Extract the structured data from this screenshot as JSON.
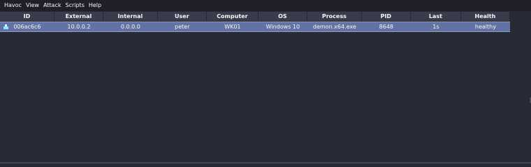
{
  "menubar": {
    "items": [
      {
        "label": "Havoc"
      },
      {
        "label": "View"
      },
      {
        "label": "Attack"
      },
      {
        "label": "Scripts"
      },
      {
        "label": "Help"
      }
    ]
  },
  "sessions_table": {
    "columns": [
      "ID",
      "External",
      "Internal",
      "User",
      "Computer",
      "OS",
      "Process",
      "PID",
      "Last",
      "Health"
    ],
    "rows": [
      {
        "icon": "agent-session-icon",
        "id": "006ac6c6",
        "external": "10.0.0.2",
        "internal": "0.0.0.0",
        "user": "peter",
        "computer": "WK01",
        "os": "Windows 10",
        "process": "demon.x64.exe",
        "pid": "8648",
        "last": "1s",
        "health": "healthy"
      }
    ]
  },
  "colors": {
    "background": "#282a36",
    "header": "#3a3c4e",
    "selected_row": "#6272a4",
    "text": "#f8f8f2"
  }
}
